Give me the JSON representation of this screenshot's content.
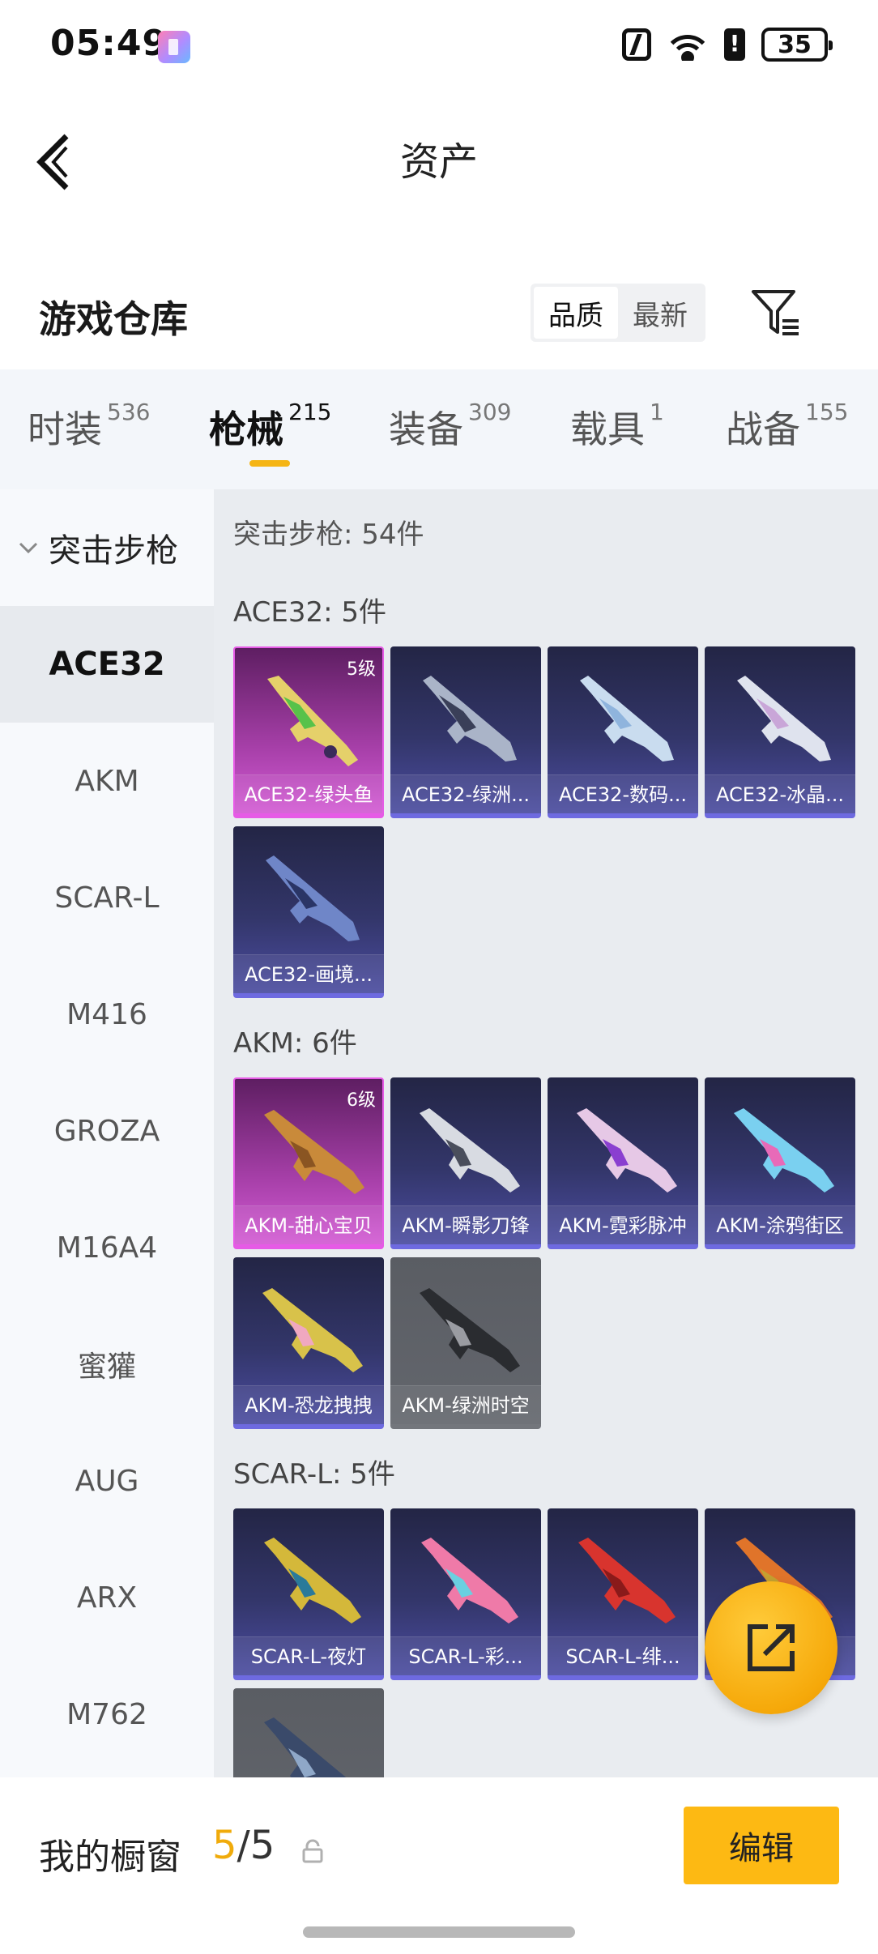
{
  "status_bar": {
    "time": "05:49",
    "battery": "35"
  },
  "header": {
    "title": "资产"
  },
  "warehouse": {
    "title": "游戏仓库",
    "sort_options": [
      "品质",
      "最新"
    ]
  },
  "tabs": [
    {
      "label": "时装",
      "count": "536"
    },
    {
      "label": "枪械",
      "count": "215"
    },
    {
      "label": "装备",
      "count": "309"
    },
    {
      "label": "载具",
      "count": "1"
    },
    {
      "label": "战备",
      "count": "155"
    }
  ],
  "sidebar": {
    "header": "突击步枪",
    "items": [
      "ACE32",
      "AKM",
      "SCAR-L",
      "M416",
      "GROZA",
      "M16A4",
      "蜜獾",
      "AUG",
      "ARX",
      "M762"
    ]
  },
  "main": {
    "summary": "突击步枪: 54件",
    "groups": [
      {
        "title": "ACE32: 5件",
        "items": [
          {
            "name": "ACE32-绿头鱼",
            "level": "5级"
          },
          {
            "name": "ACE32-绿洲..."
          },
          {
            "name": "ACE32-数码..."
          },
          {
            "name": "ACE32-冰晶..."
          },
          {
            "name": "ACE32-画境..."
          }
        ]
      },
      {
        "title": "AKM: 6件",
        "items": [
          {
            "name": "AKM-甜心宝贝",
            "level": "6级"
          },
          {
            "name": "AKM-瞬影刀锋"
          },
          {
            "name": "AKM-霓彩脉冲"
          },
          {
            "name": "AKM-涂鸦街区"
          },
          {
            "name": "AKM-恐龙拽拽"
          },
          {
            "name": "AKM-绿洲时空"
          }
        ]
      },
      {
        "title": "SCAR-L: 5件",
        "items": [
          {
            "name": "SCAR-L-夜灯"
          },
          {
            "name": "SCAR-L-彩..."
          },
          {
            "name": "SCAR-L-绯..."
          },
          {
            "name": ""
          },
          {
            "name": ""
          }
        ]
      }
    ]
  },
  "bottom": {
    "showcase_label": "我的橱窗",
    "showcase_current": "5",
    "showcase_total": "/5",
    "edit_label": "编辑"
  },
  "colors": {
    "accent": "#fdb913",
    "count_highlight": "#f0ab0b",
    "legendary_frame": "#e65be6",
    "epic_frame": "#6e6ae0"
  }
}
